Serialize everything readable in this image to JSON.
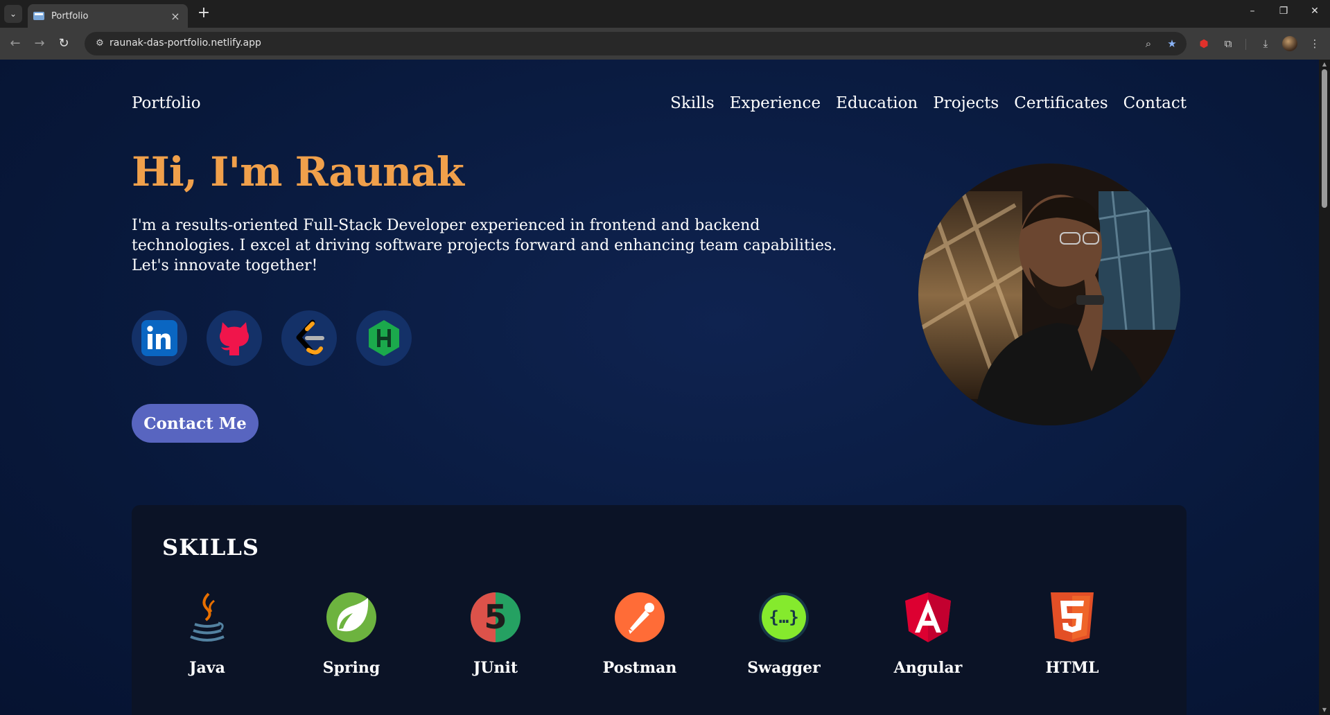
{
  "browser": {
    "tab_title": "Portfolio",
    "url": "raunak-das-portfolio.netlify.app"
  },
  "site": {
    "brand": "Portfolio",
    "nav": [
      "Skills",
      "Experience",
      "Education",
      "Projects",
      "Certificates",
      "Contact"
    ],
    "hero": {
      "title": "Hi, I'm Raunak",
      "description": "I'm a results-oriented Full-Stack Developer experienced in frontend and backend technologies. I excel at driving software projects forward and enhancing team capabilities. Let's innovate together!",
      "contact_button": "Contact Me"
    },
    "socials": [
      {
        "name": "linkedin-icon",
        "color": "#0a66c2"
      },
      {
        "name": "github-icon",
        "color": "#f0154b"
      },
      {
        "name": "leetcode-icon",
        "color": "#ffa116"
      },
      {
        "name": "hackerrank-icon",
        "color": "#1ba94c"
      }
    ],
    "skills": {
      "title": "SKILLS",
      "items": [
        "Java",
        "Spring",
        "JUnit",
        "Postman",
        "Swagger",
        "Angular",
        "HTML"
      ]
    }
  }
}
